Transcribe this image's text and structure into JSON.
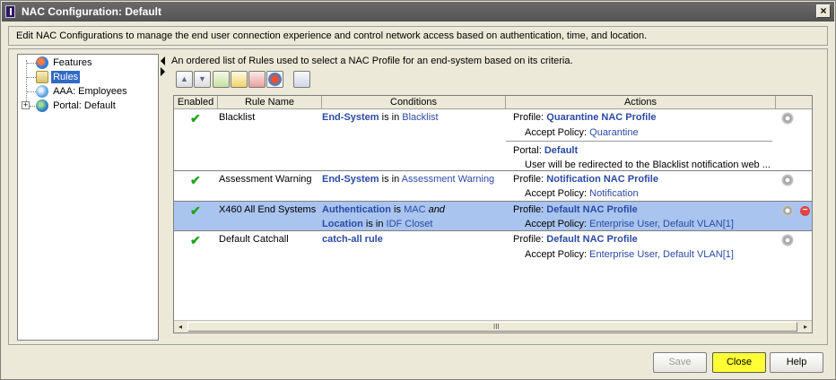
{
  "window": {
    "title": "NAC Configuration: Default",
    "close_glyph": "×"
  },
  "description": "Edit NAC Configurations to manage the end user connection experience and control network access based on authentication, time, and location.",
  "tree": {
    "items": [
      {
        "label": "Features",
        "icon": "features-icon"
      },
      {
        "label": "Rules",
        "icon": "rules-icon",
        "selected": true
      },
      {
        "label": "AAA: Employees",
        "icon": "aaa-icon"
      },
      {
        "label": "Portal: Default",
        "icon": "globe-icon",
        "expander": "+"
      }
    ]
  },
  "rules_panel": {
    "description": "An ordered list of Rules used to select a NAC Profile for an end-system based on its criteria."
  },
  "table": {
    "headers": [
      "Enabled",
      "Rule Name",
      "Conditions",
      "Actions"
    ],
    "rows": [
      {
        "name": "Blacklist",
        "enabled_glyph": "✔",
        "cond": [
          {
            "key": "End-System",
            "op": " is in ",
            "val": "Blacklist"
          }
        ],
        "profile_label": "Profile: ",
        "profile": "Quarantine NAC Profile",
        "policy_label": "Accept Policy: ",
        "policy": "Quarantine",
        "portal_label": "Portal: ",
        "portal": "Default",
        "portal_note": "User will be redirected to the Blacklist notification web ..."
      },
      {
        "name": "Assessment Warning",
        "enabled_glyph": "✔",
        "cond": [
          {
            "key": "End-System",
            "op": " is in ",
            "val": "Assessment Warning"
          }
        ],
        "profile_label": "Profile: ",
        "profile": "Notification NAC Profile",
        "policy_label": "Accept Policy: ",
        "policy": "Notification"
      },
      {
        "name": "X460 All End Systems",
        "enabled_glyph": "✔",
        "selected": true,
        "cond": [
          {
            "key": "Authentication",
            "op": " is ",
            "val": "MAC",
            "suffix": " and"
          },
          {
            "key": "Location",
            "op": " is in ",
            "val": "IDF Closet"
          }
        ],
        "profile_label": "Profile: ",
        "profile": "Default NAC Profile",
        "policy_label": "Accept Policy: ",
        "policy": "Enterprise User, Default VLAN[1]"
      },
      {
        "name": "Default Catchall",
        "enabled_glyph": "✔",
        "cond": [
          {
            "key": "catch-all rule"
          }
        ],
        "profile_label": "Profile: ",
        "profile": "Default NAC Profile",
        "policy_label": "Accept Policy: ",
        "policy": "Enterprise User, Default VLAN[1]"
      }
    ]
  },
  "scrollbar": {
    "grip": "III",
    "left": "◂",
    "right": "▸"
  },
  "buttons": {
    "save": "Save",
    "close": "Close",
    "help": "Help"
  },
  "colors": {
    "accent_selected": "#a9c4ef",
    "link_blue": "#2b4aa3",
    "check_green": "#1ea51e",
    "close_yellow": "#ffff33"
  }
}
